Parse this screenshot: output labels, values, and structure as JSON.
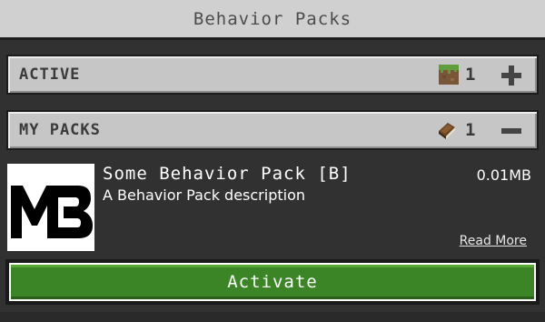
{
  "window": {
    "title": "Behavior Packs"
  },
  "sections": {
    "active": {
      "label": "ACTIVE",
      "count": "1",
      "count_icon": "grass-block-icon",
      "action_icon": "plus-icon"
    },
    "my_packs": {
      "label": "MY PACKS",
      "count": "1",
      "count_icon": "book-icon",
      "action_icon": "minus-icon"
    }
  },
  "pack": {
    "name": "Some Behavior Pack [B]",
    "description": "A Behavior Pack description",
    "size": "0.01MB",
    "logo_text": "MB",
    "read_more": "Read More"
  },
  "buttons": {
    "activate": "Activate"
  },
  "colors": {
    "header_bg": "#d0d0d0",
    "panel_bg": "#c6c6c6",
    "body_bg": "#313131",
    "activate_green": "#3c8526"
  }
}
